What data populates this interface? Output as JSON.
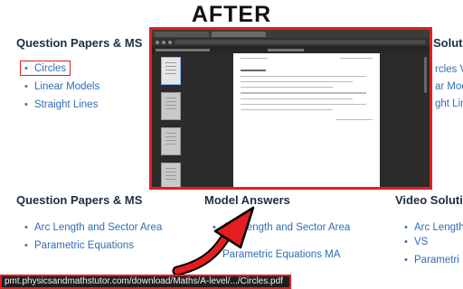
{
  "label_after": "AFTER",
  "top_section": {
    "heading": "Question Papers & MS",
    "items": [
      "Circles",
      "Linear Models",
      "Straight Lines"
    ],
    "right_heading_partial": "Solutio",
    "right_items_partial": [
      "rcles VS",
      "ar Models",
      "ght Lines"
    ]
  },
  "bottom_section": {
    "col1": {
      "heading": "Question Papers & MS",
      "items": [
        "Arc Length and Sector Area",
        "Parametric Equations"
      ]
    },
    "col2": {
      "heading": "Model Answers",
      "items": [
        "Arc Length and Sector Area",
        "Parametric Equations MA"
      ]
    },
    "col3": {
      "heading": "Video Solutio",
      "items": [
        "Arc Length",
        "VS",
        "Parametri"
      ]
    }
  },
  "status_url": "pmt.physicsandmathstutor.com/download/Maths/A-level/.../Circles.pdf",
  "colors": {
    "highlight": "#e41e1e",
    "link": "#2f6db6",
    "heading": "#1f2d3d"
  }
}
